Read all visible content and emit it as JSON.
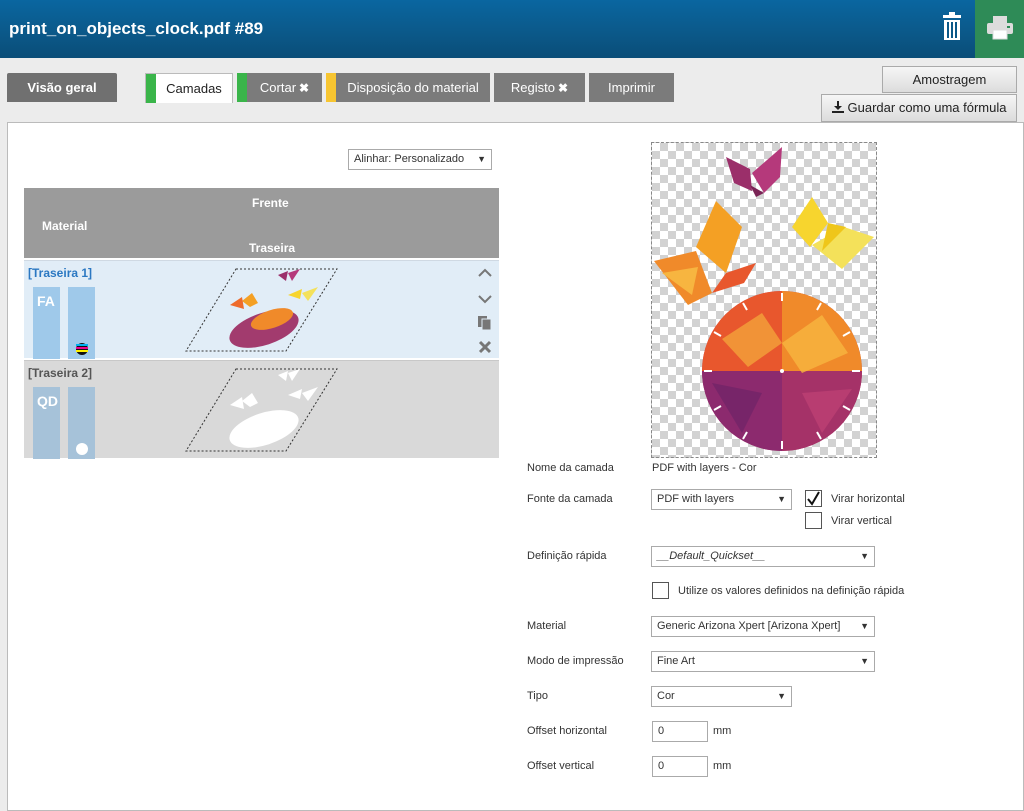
{
  "window": {
    "title": "print_on_objects_clock.pdf #89"
  },
  "icons": {
    "trash": "trash-icon",
    "print": "printer-icon"
  },
  "colors": {
    "titlebar": "#0b5888",
    "print_button": "#2e8b57",
    "mark_green": "#3ab54a",
    "mark_yellow": "#f7c531",
    "link_blue": "#2b78c2"
  },
  "tabs": {
    "overview": "Visão geral",
    "layers": "Camadas",
    "cut": "Cortar",
    "layout": "Disposição do material",
    "register": "Registo",
    "print": "Imprimir",
    "close_glyph": "✖"
  },
  "buttons": {
    "sample": "Amostragem",
    "save_formula": "Guardar como uma fórmula"
  },
  "align": {
    "value": "Alinhar: Personalizado"
  },
  "table": {
    "header_front": "Frente",
    "header_material": "Material",
    "header_back": "Traseira",
    "rows": [
      {
        "label": "[Traseira 1]",
        "badge": "FA"
      },
      {
        "label": "[Traseira 2]",
        "badge": "QD"
      }
    ]
  },
  "props": {
    "layer_name_label": "Nome da camada",
    "layer_name_value": "PDF with layers - Cor",
    "layer_source_label": "Fonte da camada",
    "layer_source_value": "PDF with layers",
    "flip_h": "Virar horizontal",
    "flip_v": "Virar vertical",
    "quickset_label": "Definição rápida",
    "quickset_value": "__Default_Quickset__",
    "use_quickset": "Utilize os valores definidos na definição rápida",
    "material_label": "Material",
    "material_value": "Generic Arizona Xpert [Arizona Xpert]",
    "print_mode_label": "Modo de impressão",
    "print_mode_value": "Fine Art",
    "type_label": "Tipo",
    "type_value": "Cor",
    "offset_h_label": "Offset horizontal",
    "offset_h_value": "0",
    "offset_v_label": "Offset vertical",
    "offset_v_value": "0",
    "unit": "mm"
  }
}
